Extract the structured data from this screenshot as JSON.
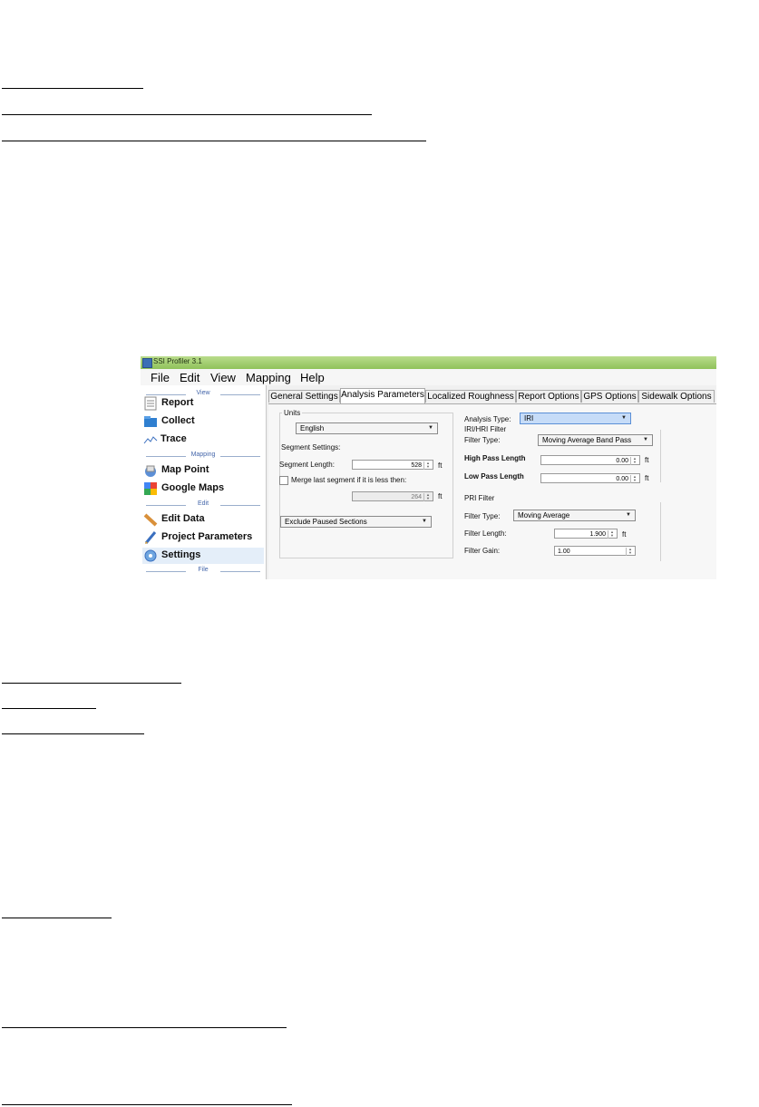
{
  "app": {
    "title": "SSI Profiler 3.1",
    "menu": [
      "File",
      "Edit",
      "View",
      "Mapping",
      "Help"
    ],
    "sidebar": {
      "sections": [
        "View",
        "Mapping",
        "Edit",
        "File"
      ],
      "items": [
        {
          "label": "Report",
          "icon": "report-icon"
        },
        {
          "label": "Collect",
          "icon": "collect-icon"
        },
        {
          "label": "Trace",
          "icon": "trace-icon"
        },
        {
          "label": "Map Point",
          "icon": "map-point-icon"
        },
        {
          "label": "Google Maps",
          "icon": "google-maps-icon"
        },
        {
          "label": "Edit Data",
          "icon": "edit-data-icon"
        },
        {
          "label": "Project Parameters",
          "icon": "project-parameters-icon"
        },
        {
          "label": "Settings",
          "icon": "settings-icon"
        }
      ]
    },
    "tabs": [
      "General Settings",
      "Analysis Parameters",
      "Localized Roughness",
      "Report Options",
      "GPS Options",
      "Sidewalk Options"
    ],
    "active_tab": "Analysis Parameters",
    "units": {
      "label": "Units",
      "value": "English"
    },
    "segment": {
      "heading": "Segment Settings:",
      "length_label": "Segment Length:",
      "length_value": "528",
      "length_unit": "ft",
      "merge_label": "Merge last segment if it is less then:",
      "merge_value": "264",
      "merge_unit": "ft",
      "exclude_value": "Exclude Paused Sections"
    },
    "analysis_type": {
      "label": "Analysis Type:",
      "value": "IRI"
    },
    "iri_filter": {
      "heading": "IRI/HRI Filter",
      "filter_type_label": "Filter Type:",
      "filter_type_value": "Moving Average Band Pass",
      "high_pass_label": "High Pass Length",
      "high_pass_value": "0.00",
      "high_pass_unit": "ft",
      "low_pass_label": "Low Pass Length",
      "low_pass_value": "0.00",
      "low_pass_unit": "ft"
    },
    "pri_filter": {
      "heading": "PRI Filter",
      "filter_type_label": "Filter Type:",
      "filter_type_value": "Moving Average",
      "length_label": "Filter Length:",
      "length_value": "1.900",
      "length_unit": "ft",
      "gain_label": "Filter Gain:",
      "gain_value": "1.00"
    },
    "colors": {
      "titlebar": "#9ccc65",
      "selected_combo": "#c6dcf8"
    }
  }
}
